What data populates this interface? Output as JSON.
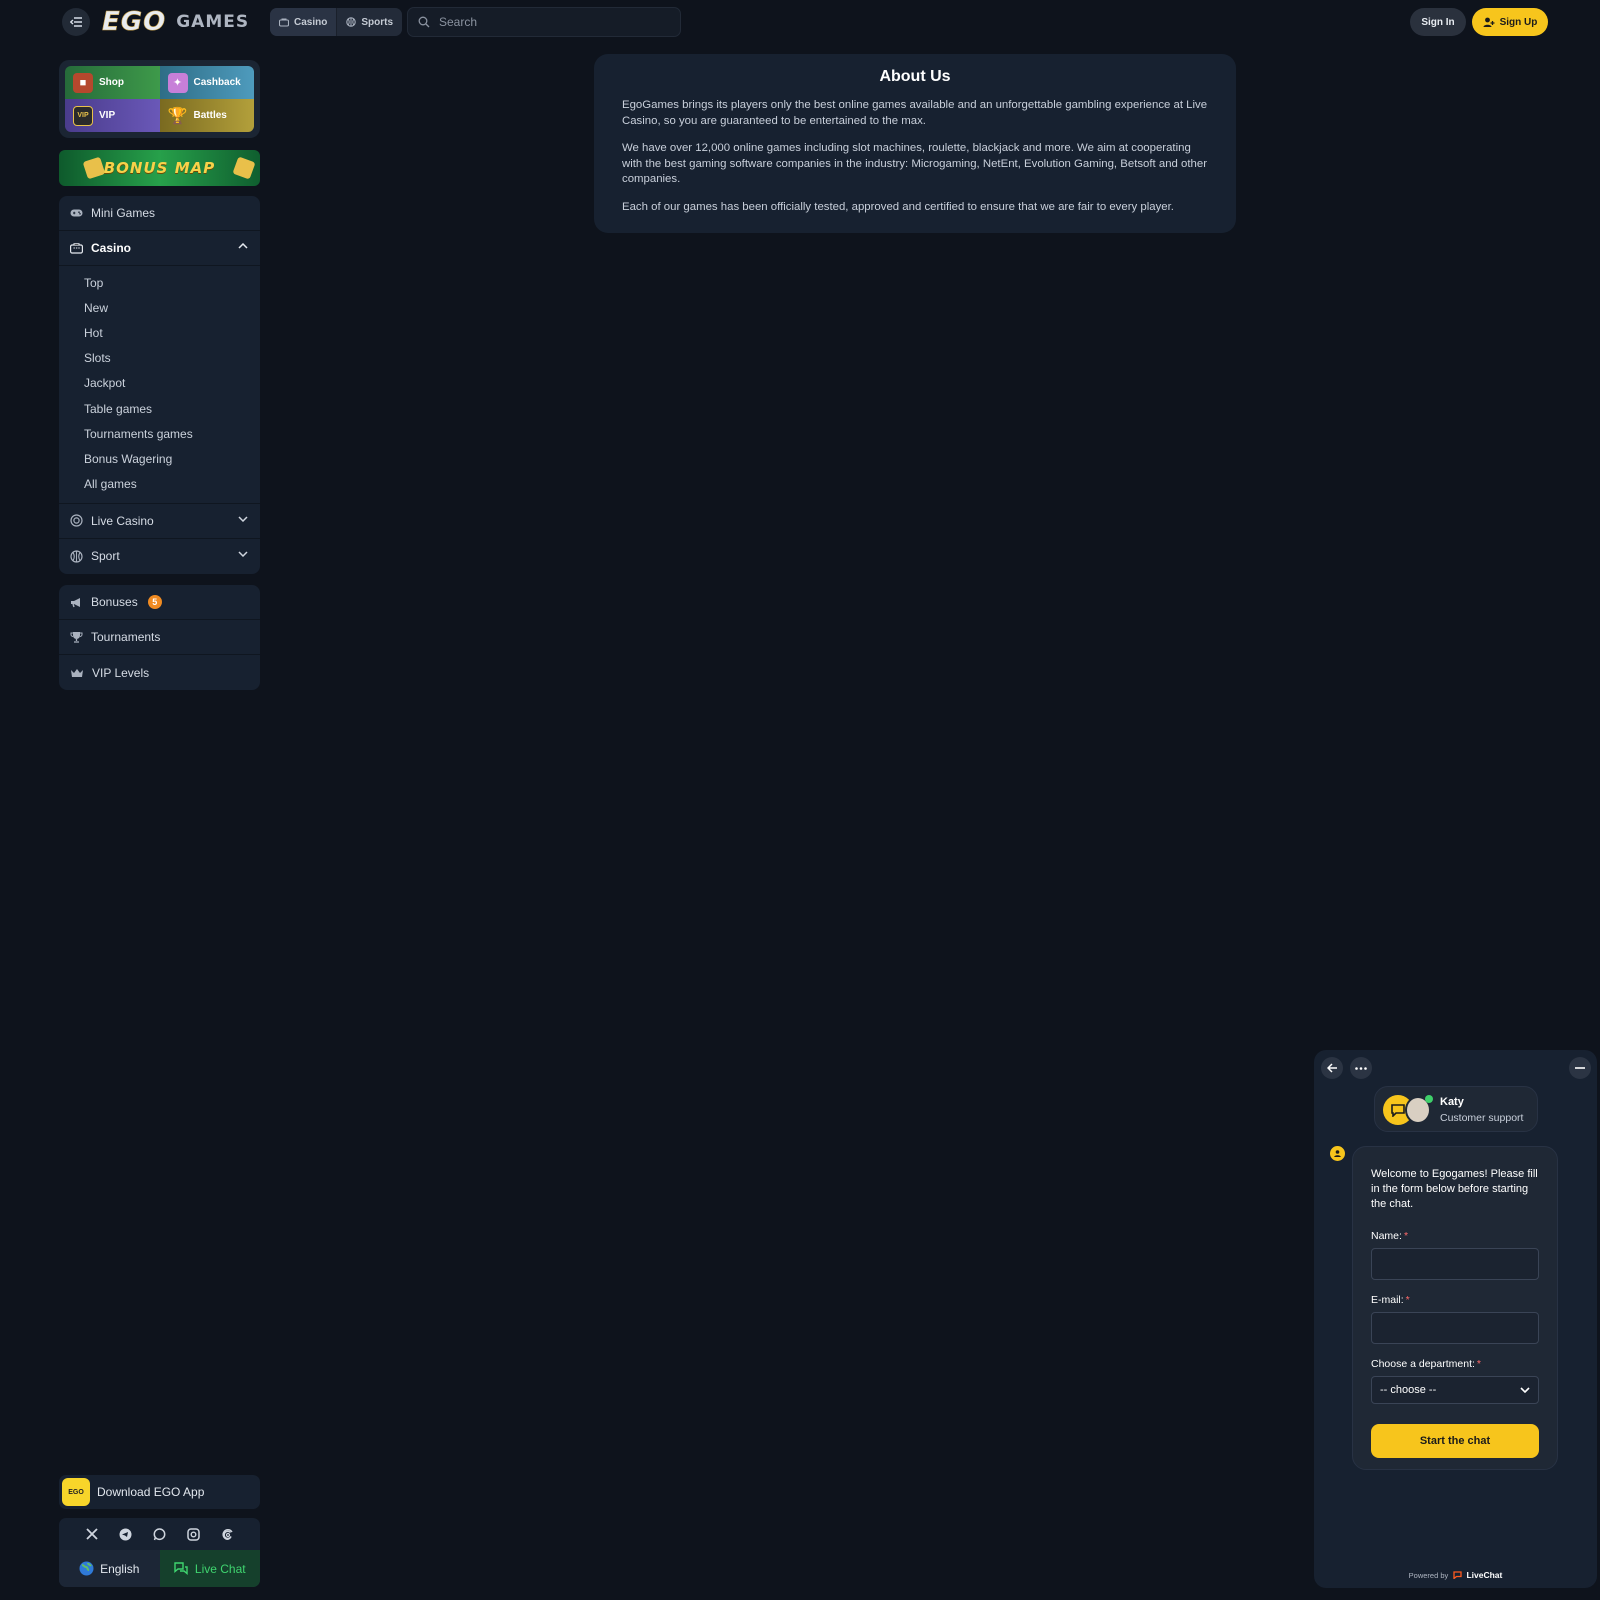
{
  "header": {
    "logo_ego": "EGO",
    "logo_games": "GAMES",
    "modes": [
      {
        "label": "Casino",
        "icon": "casino-icon"
      },
      {
        "label": "Sports",
        "icon": "sports-icon"
      }
    ],
    "search_placeholder": "Search",
    "sign_in": "Sign In",
    "sign_up": "Sign Up",
    "accent": "#f7c51c"
  },
  "promos": {
    "shop": "Shop",
    "cashback": "Cashback",
    "vip": "VIP",
    "battles": "Battles",
    "bonus_map": "BONUS MAP"
  },
  "nav": {
    "mini_games": "Mini Games",
    "casino": "Casino",
    "casino_items": [
      "Top",
      "New",
      "Hot",
      "Slots",
      "Jackpot",
      "Table games",
      "Tournaments games",
      "Bonus Wagering",
      "All games"
    ],
    "live_casino": "Live Casino",
    "sport": "Sport"
  },
  "extras": {
    "bonuses": "Bonuses",
    "bonuses_count": "5",
    "tournaments": "Tournaments",
    "vip_levels": "VIP Levels"
  },
  "footer": {
    "app_logo": "EGO",
    "download_app": "Download EGO App",
    "socials": [
      "x-icon",
      "telegram-icon",
      "whatsapp-icon",
      "instagram-icon",
      "threads-icon"
    ],
    "language": "English",
    "live_chat": "Live Chat"
  },
  "about": {
    "title": "About Us",
    "p1": "EgoGames brings its players only the best online games available and an unforgettable gambling experience at Live Casino, so you are guaranteed to be entertained to the max.",
    "p2": "We have over 12,000 online games including slot machines, roulette, blackjack and more. We aim at cooperating with the best gaming software companies in the industry: Microgaming, NetEnt, Evolution Gaming, Betsoft and other companies.",
    "p3": "Each of our games has been officially tested, approved and certified to ensure that we are fair to every player."
  },
  "chat": {
    "agent_name": "Katy",
    "agent_role": "Customer support",
    "welcome": "Welcome to Egogames! Please fill in the form below before starting the chat.",
    "name_label": "Name:",
    "email_label": "E-mail:",
    "department_label": "Choose a department:",
    "required_mark": "*",
    "department_value": "-- choose --",
    "start_button": "Start the chat",
    "powered_by": "Powered by",
    "brand": "LiveChat"
  }
}
